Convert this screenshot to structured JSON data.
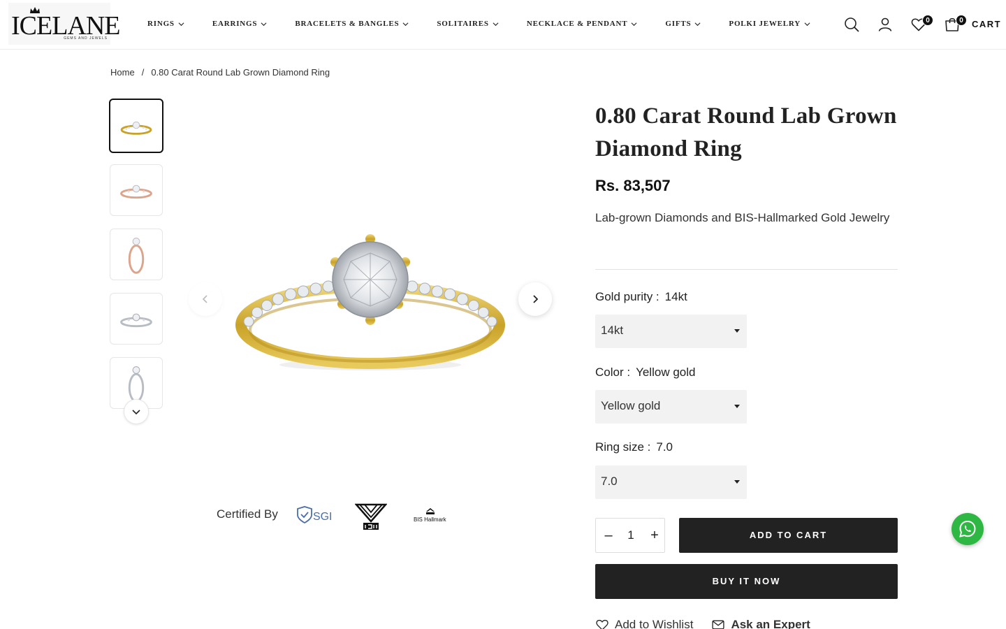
{
  "brand": {
    "name": "ICELANE",
    "tagline": "GEMS AND JEWELS"
  },
  "nav": {
    "items": [
      {
        "label": "RINGS"
      },
      {
        "label": "EARRINGS"
      },
      {
        "label": "BRACELETS & BANGLES"
      },
      {
        "label": "SOLITAIRES"
      },
      {
        "label": "NECKLACE & PENDANT"
      },
      {
        "label": "GIFTS"
      },
      {
        "label": "POLKI JEWELRY"
      }
    ]
  },
  "header": {
    "wishlist_count": "0",
    "cart_count": "0",
    "cart_label": "CART",
    "icons": [
      "search-icon",
      "account-icon",
      "heart-icon",
      "bag-icon"
    ]
  },
  "breadcrumb": {
    "home": "Home",
    "separator": "/",
    "current": "0.80 Carat Round Lab Grown Diamond Ring"
  },
  "gallery": {
    "thumbnails": [
      {
        "metal": "yellow"
      },
      {
        "metal": "rose"
      },
      {
        "metal": "rose-side"
      },
      {
        "metal": "white"
      },
      {
        "metal": "white-side"
      }
    ]
  },
  "certified": {
    "label": "Certified By",
    "logos": [
      "SGL",
      "IGI",
      "BIS Hallmark"
    ],
    "sgl_text": "SGL",
    "bis_text": "BIS Hallmark"
  },
  "product": {
    "title": "0.80 Carat Round Lab Grown Diamond Ring",
    "price": "Rs. 83,507",
    "description": "Lab-grown Diamonds and BIS-Hallmarked Gold Jewelry",
    "options": {
      "purity": {
        "label": "Gold purity :",
        "value": "14kt",
        "selected": "14kt"
      },
      "color": {
        "label": "Color :",
        "value": "Yellow gold",
        "selected": "Yellow gold"
      },
      "size": {
        "label": "Ring size :",
        "value": "7.0",
        "selected": "7.0"
      }
    },
    "quantity": "1",
    "minus": "–",
    "plus": "+",
    "add_to_cart": "ADD TO CART",
    "buy_now": "BUY IT NOW",
    "wishlist_link": "Add to Wishlist",
    "expert_link": "Ask an Expert"
  },
  "colors": {
    "button_dark": "#222222",
    "whatsapp": "#2fb744",
    "gold": "#c9a227"
  }
}
